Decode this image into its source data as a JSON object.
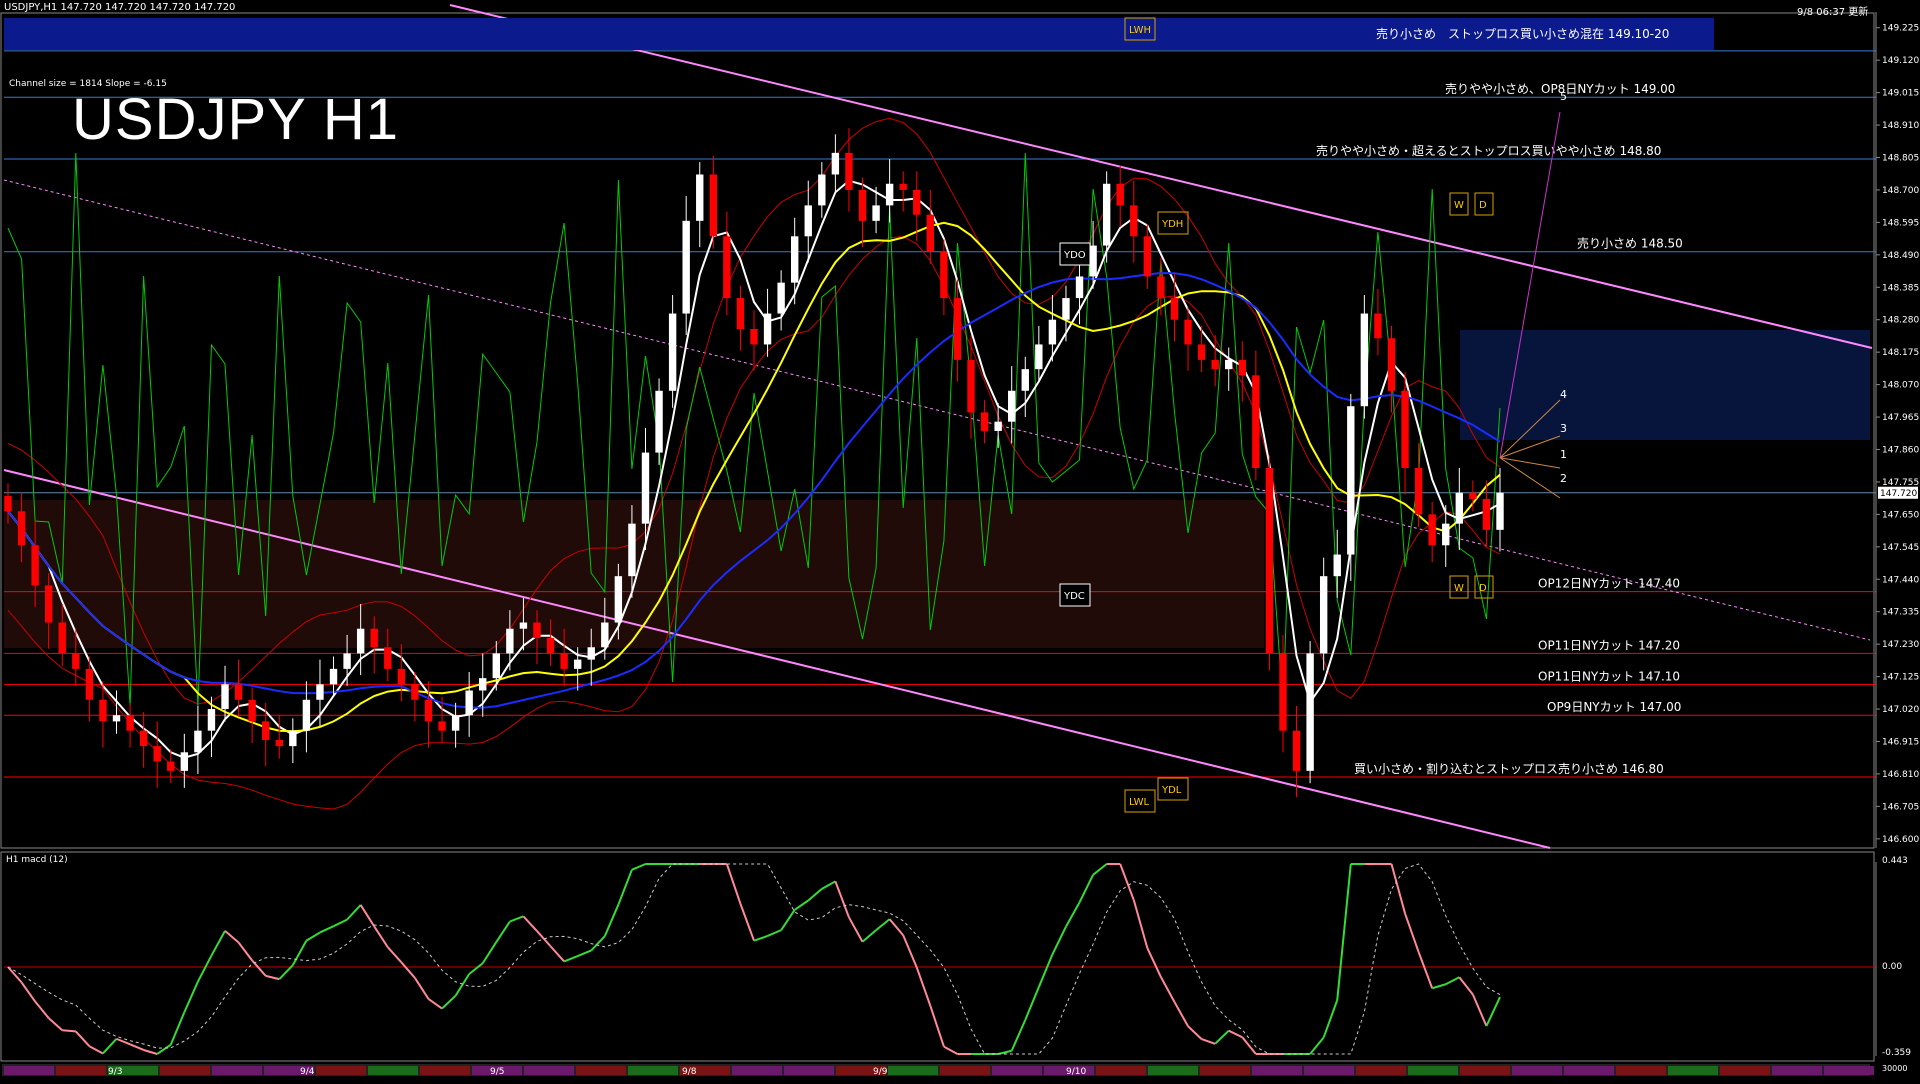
{
  "header": {
    "symbol_line": "USDJPY,H1  147.720 147.720 147.720 147.720",
    "big_title": "USDJPY H1",
    "channel_info": "Channel size = 1814 Slope = -6.15",
    "datetime": "9/8 06:37",
    "update_label": "更新"
  },
  "subwindow": {
    "label": "H1  macd (12)",
    "axis_top": "0.443",
    "axis_zero": "0.00",
    "axis_bottom": "-0.359",
    "footer_label": "30000"
  },
  "colors": {
    "background": "#000000",
    "banner": "#0b1a8c",
    "bull_candle": "#ffffff",
    "bear_candle": "#ff0000",
    "ma_white": "#ffffff",
    "ma_yellow": "#ffff00",
    "ma_blue": "#1a2cff",
    "oscillator_green": "#00cc00",
    "channel_pink": "#ff88ff",
    "level_line_red": "#ff0000",
    "level_line_blue": "#3a7ad4",
    "macd_green": "#33dd33",
    "macd_pink": "#ff8899"
  },
  "level_labels": [
    {
      "text": "売り小さめ　ストップロス買い小さめ混在 149.10-20"
    },
    {
      "text": "売りやや小さめ、OP8日NYカット 149.00"
    },
    {
      "text": "売りやや小さめ・超えるとストップロス買いやや小さめ 148.80"
    },
    {
      "text": "売り小さめ 148.50"
    },
    {
      "text": "OP12日NYカット 147.40"
    },
    {
      "text": "OP11日NYカット 147.20"
    },
    {
      "text": "OP11日NYカット 147.10"
    },
    {
      "text": "OP9日NYカット 147.00"
    },
    {
      "text": "買い小さめ・割り込むとストップロス売り小さめ 146.80"
    }
  ],
  "chart_markers": [
    "LWH",
    "YDH",
    "YDO",
    "YDC",
    "YDL",
    "LWL",
    "W",
    "D",
    "W",
    "D"
  ],
  "projection_labels": [
    "5",
    "4",
    "3",
    "1",
    "2"
  ],
  "session_labels": [
    "9/3",
    "9/4",
    "9/5",
    "9/8",
    "9/9",
    "9/10"
  ],
  "current_price": "147.720",
  "chart_data": {
    "type": "candlestick",
    "title": "USDJPY H1",
    "y_axis_ticks": [
      "149.225",
      "149.120",
      "149.015",
      "148.910",
      "148.805",
      "148.700",
      "148.595",
      "148.490",
      "148.385",
      "148.280",
      "148.175",
      "148.070",
      "147.965",
      "147.860",
      "147.755",
      "147.650",
      "147.545",
      "147.440",
      "147.335",
      "147.230",
      "147.125",
      "147.020",
      "146.915",
      "146.810",
      "146.705",
      "146.600"
    ],
    "ylim": [
      146.58,
      149.25
    ],
    "current_price": 147.72,
    "levels": [
      149.15,
      149.0,
      148.8,
      148.5,
      147.4,
      147.2,
      147.1,
      147.0,
      146.8
    ],
    "close": [
      147.66,
      147.55,
      147.42,
      147.3,
      147.2,
      147.15,
      147.05,
      146.98,
      147.0,
      146.95,
      146.9,
      146.85,
      146.82,
      146.88,
      146.95,
      147.02,
      147.1,
      147.05,
      146.98,
      146.92,
      146.9,
      146.95,
      147.05,
      147.1,
      147.15,
      147.2,
      147.28,
      147.22,
      147.15,
      147.1,
      147.05,
      146.98,
      146.95,
      147.0,
      147.08,
      147.12,
      147.2,
      147.28,
      147.3,
      147.25,
      147.2,
      147.15,
      147.18,
      147.22,
      147.3,
      147.45,
      147.62,
      147.85,
      148.05,
      148.3,
      148.6,
      148.75,
      148.55,
      148.35,
      148.25,
      148.2,
      148.3,
      148.4,
      148.55,
      148.65,
      148.75,
      148.82,
      148.7,
      148.6,
      148.65,
      148.72,
      148.7,
      148.62,
      148.5,
      148.35,
      148.15,
      147.98,
      147.92,
      147.95,
      148.05,
      148.12,
      148.2,
      148.28,
      148.35,
      148.42,
      148.52,
      148.72,
      148.65,
      148.55,
      148.42,
      148.35,
      148.28,
      148.2,
      148.15,
      148.12,
      148.15,
      148.1,
      147.8,
      147.2,
      146.95,
      146.82,
      147.2,
      147.45,
      147.52,
      148.0,
      148.3,
      148.22,
      148.05,
      147.8,
      147.65,
      147.55,
      147.62,
      147.72,
      147.7,
      147.6,
      147.72
    ]
  }
}
